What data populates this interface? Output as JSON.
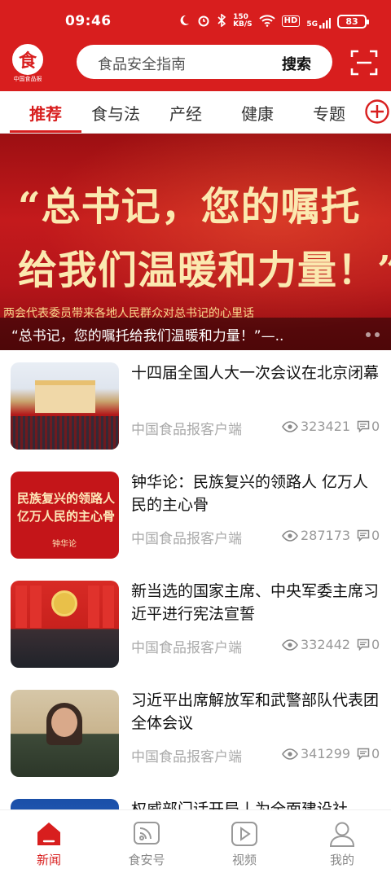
{
  "status": {
    "time": "09:46",
    "speed_value": "150",
    "speed_unit": "KB/S",
    "battery": "83",
    "hd_label": "HD",
    "network": "5G"
  },
  "header": {
    "logo_glyph": "食",
    "logo_text": "中国食品报",
    "search_placeholder": "食品安全指南",
    "search_button": "搜索"
  },
  "tabs": [
    {
      "label": "推荐",
      "active": true
    },
    {
      "label": "食与法"
    },
    {
      "label": "产经"
    },
    {
      "label": "健康"
    },
    {
      "label": "专题"
    }
  ],
  "banner": {
    "headline_line1": "“总书记，您的嘱托",
    "headline_line2": "给我们温暖和力量！”",
    "strip_text": "两会代表委员带来各地人民群众对总书记的心里话",
    "caption": "“总书记，您的嘱托给我们温暖和力量！”—.."
  },
  "news": [
    {
      "title": "十四届全国人大一次会议在北京闭幕",
      "source": "中国食品报客户端",
      "views": "323421",
      "comments": "0"
    },
    {
      "title": "钟华论：民族复兴的领路人 亿万人民的主心骨",
      "source": "中国食品报客户端",
      "views": "287173",
      "comments": "0",
      "thumb_text": "民族复兴的领路人 亿万人民的主心骨",
      "thumb_seal": "钟华论"
    },
    {
      "title": "新当选的国家主席、中央军委主席习近平进行宪法宣誓",
      "source": "中国食品报客户端",
      "views": "332442",
      "comments": "0"
    },
    {
      "title": "习近平出席解放军和武警部队代表团全体会议",
      "source": "中国食品报客户端",
      "views": "341299",
      "comments": "0"
    },
    {
      "title": "权威部门话开局丨为全面建设社"
    }
  ],
  "bottom_nav": [
    {
      "label": "新闻",
      "icon": "home-icon",
      "active": true
    },
    {
      "label": "食安号",
      "icon": "broadcast-icon"
    },
    {
      "label": "视频",
      "icon": "play-icon"
    },
    {
      "label": "我的",
      "icon": "user-icon"
    }
  ],
  "colors": {
    "brand_red": "#d81e1e",
    "banner_text": "#fbe9b0"
  }
}
